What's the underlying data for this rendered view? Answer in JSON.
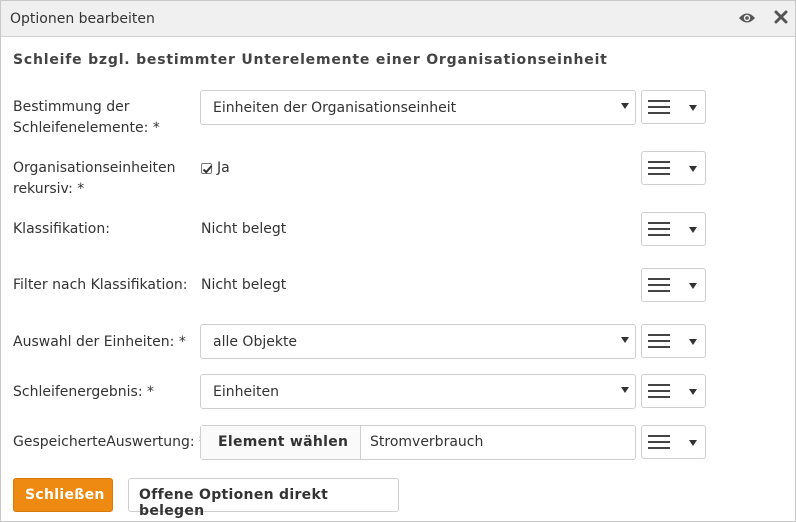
{
  "dialog": {
    "title": "Optionen bearbeiten",
    "icons": {
      "visibility": "eye-icon",
      "close": "close-icon"
    },
    "heading": "Schleife bzgl. bestimmter Unterelemente einer Organisationseinheit"
  },
  "fields": {
    "bestimmung": {
      "label_line1": "Bestimmung der",
      "label_line2": "Schleifenelemente: *",
      "value": "Einheiten der Organisationseinheit"
    },
    "rekursiv": {
      "label_line1": "Organisationseinheiten",
      "label_line2": "rekursiv: *",
      "checked": true,
      "check_label": "Ja"
    },
    "klassifikation": {
      "label": "Klassifikation:",
      "value": "Nicht belegt"
    },
    "filter": {
      "label": "Filter nach Klassifikation:",
      "value": "Nicht belegt"
    },
    "auswahl": {
      "label": "Auswahl der Einheiten: *",
      "value": "alle Objekte"
    },
    "ergebnis": {
      "label": "Schleifenergebnis: *",
      "value": "Einheiten"
    },
    "auswertung": {
      "label": "GespeicherteAuswertung: *",
      "button": "Element wählen",
      "value": "Stromverbrauch"
    }
  },
  "option_menu": {
    "icon": "hamburger-menu-icon"
  },
  "buttons": {
    "close": "Schließen",
    "apply_open": "Offene Optionen direkt belegen"
  },
  "colors": {
    "primary": "#ee8a12",
    "titlebar": "#f0f0f0",
    "border": "#cfcfcf"
  }
}
